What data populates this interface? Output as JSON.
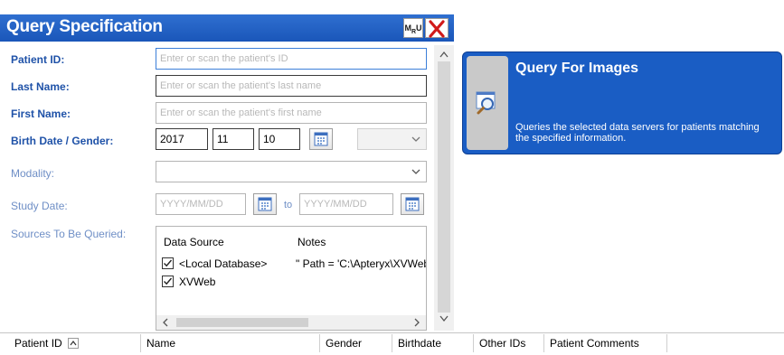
{
  "panel": {
    "title": "Query Specification",
    "mru_label": "MRU"
  },
  "form": {
    "patient_id_label": "Patient ID:",
    "patient_id_placeholder": "Enter or scan the patient's ID",
    "last_name_label": "Last Name:",
    "last_name_placeholder": "Enter or scan the patient's last name",
    "first_name_label": "First Name:",
    "first_name_placeholder": "Enter or scan the patient's first name",
    "birth_gender_label": "Birth Date / Gender:",
    "birth_year": "2017",
    "birth_month": "11",
    "birth_day": "10",
    "gender_value": "",
    "modality_label": "Modality:",
    "modality_value": "",
    "study_date_label": "Study Date:",
    "study_date_from_placeholder": "YYYY/MM/DD",
    "study_date_to_label": "to",
    "study_date_to_placeholder": "YYYY/MM/DD",
    "sources_label": "Sources To Be Queried:"
  },
  "sources": {
    "columns": [
      "Data Source",
      "Notes"
    ],
    "rows": [
      {
        "name": "<Local Database>",
        "notes": "\" Path = 'C:\\Apteryx\\XVWeb",
        "checked": true
      },
      {
        "name": "XVWeb",
        "notes": "",
        "checked": true
      }
    ]
  },
  "query_card": {
    "title": "Query For Images",
    "description": "Queries the selected data servers for patients matching the specified information.",
    "accent": "#1a5dc4"
  },
  "results_grid": {
    "columns": [
      "Patient ID",
      "Name",
      "Gender",
      "Birthdate",
      "Other IDs",
      "Patient Comments"
    ]
  }
}
